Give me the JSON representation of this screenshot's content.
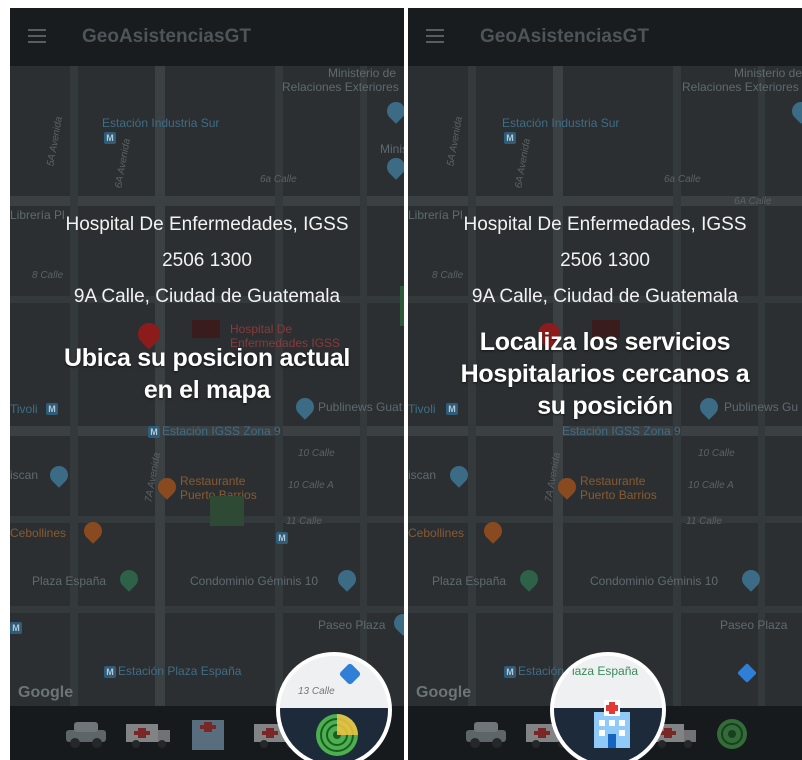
{
  "app": {
    "title": "GeoAsistenciasGT"
  },
  "hospital": {
    "name": "Hospital De Enfermedades, IGSS",
    "phone": "2506 1300",
    "address": "9A Calle, Ciudad de Guatemala"
  },
  "map": {
    "poi": {
      "ministerio": "Ministerio de",
      "relaciones": "Relaciones Exteriores",
      "estacion_industria": "Estación Industria Sur",
      "minis": "Minis",
      "libreria": "Librería Pl",
      "tivoli": "Tivoli",
      "publinews": "Publinews Guat",
      "publinews2": "Publinews Gu",
      "estacion_igss": "Estación IGSS Zona 9",
      "iscan": "iscan",
      "restaurante1": "Restaurante",
      "restaurante2": "Puerto Barrios",
      "cebollines": "Cebollines",
      "plaza_espana": "Plaza España",
      "condominio": "Condominio Géminis 10",
      "paseo_plaza": "Paseo Plaza",
      "estacion_plaza": "Estación Plaza España",
      "hospital_label1": "Hospital De",
      "hospital_label2": "Enfermedades IGSS"
    },
    "streets": {
      "avenida5": "5A Avenida",
      "avenida6": "6A Avenida",
      "calle6": "6a Calle",
      "calle6a": "6A Calle",
      "calle8": "8 Calle",
      "calle10": "10 Calle",
      "calle10a": "10 Calle A",
      "calle11": "11 Calle",
      "avenida7": "7A Avenida",
      "calle13": "13 Calle"
    },
    "google_logo": "Google"
  },
  "panels": [
    {
      "message": "Ubica su posicion actual en el mapa",
      "lines": [
        "Ubica su posicion actual",
        "en el mapa"
      ]
    },
    {
      "message": "Localiza los servicios Hospitalarios cercanos a su posición",
      "lines": [
        "Localiza los servicios",
        "Hospitalarios cercanos a",
        "su posición"
      ]
    }
  ],
  "bottom_nav": [
    "taxi-icon",
    "ambulance-icon",
    "hospital-icon",
    "ambulance-icon",
    "radar-icon"
  ],
  "colors": {
    "accent_red": "#d32f2f",
    "radar_green": "#4caf50",
    "app_bar": "#181c1e"
  }
}
